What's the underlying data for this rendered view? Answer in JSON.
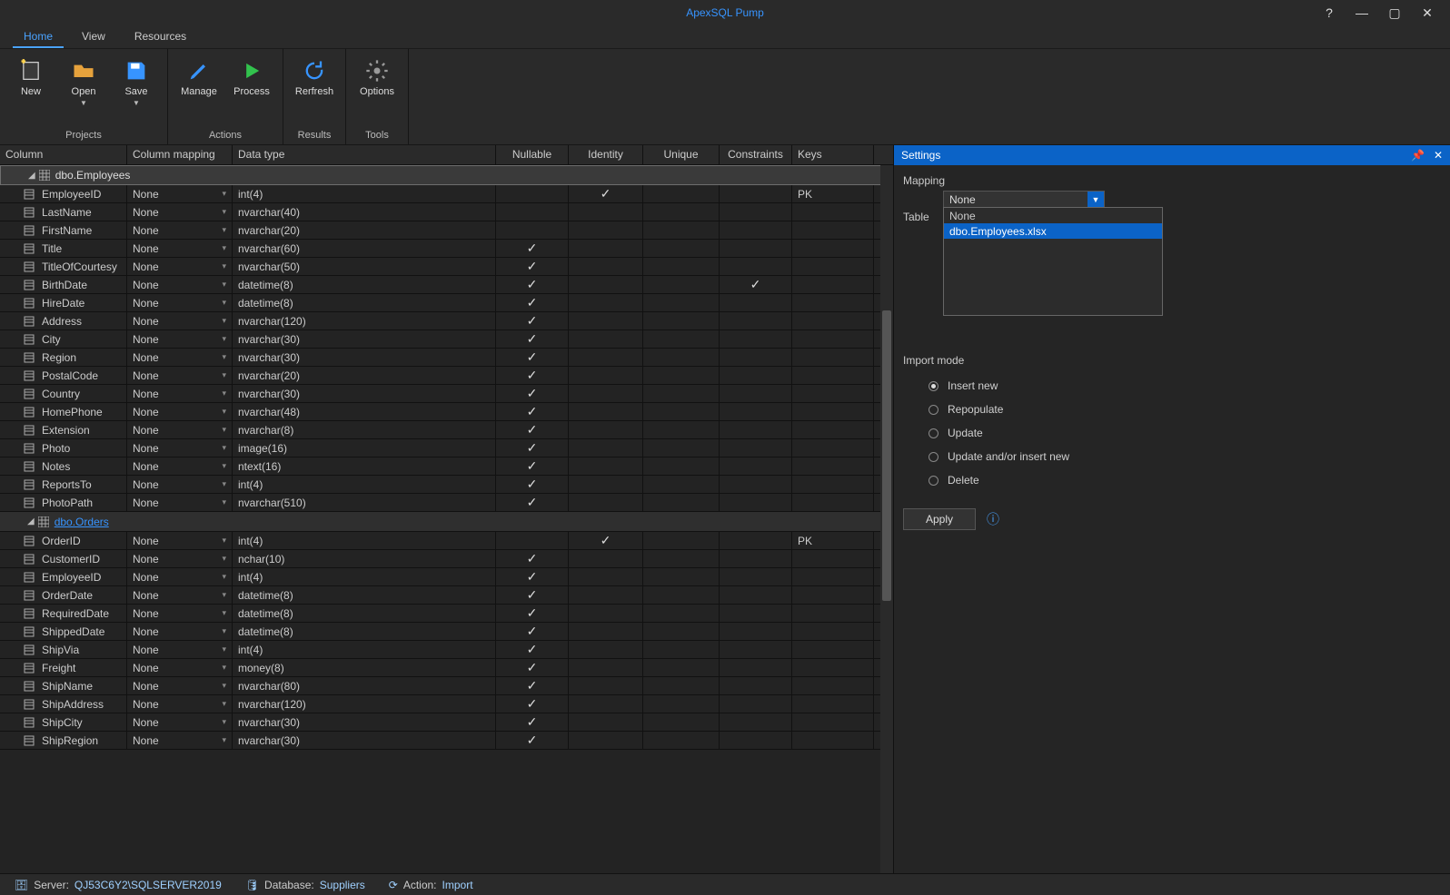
{
  "app_title": "ApexSQL Pump",
  "ribbon_tabs": [
    "Home",
    "View",
    "Resources"
  ],
  "active_tab": 0,
  "ribbon_groups": [
    {
      "label": "Projects",
      "buttons": [
        {
          "name": "New",
          "dropdown": false
        },
        {
          "name": "Open",
          "dropdown": true
        },
        {
          "name": "Save",
          "dropdown": true
        }
      ]
    },
    {
      "label": "Actions",
      "buttons": [
        {
          "name": "Manage",
          "dropdown": false
        },
        {
          "name": "Process",
          "dropdown": false
        }
      ]
    },
    {
      "label": "Results",
      "buttons": [
        {
          "name": "Rerfresh",
          "dropdown": false
        }
      ]
    },
    {
      "label": "Tools",
      "buttons": [
        {
          "name": "Options",
          "dropdown": false
        }
      ]
    }
  ],
  "grid_columns": [
    "Column",
    "Column mapping",
    "Data type",
    "Nullable",
    "Identity",
    "Unique",
    "Constraints",
    "Keys"
  ],
  "tables": [
    {
      "name": "dbo.Employees",
      "selected": true,
      "link": false,
      "cols": [
        {
          "n": "EmployeeID",
          "m": "None",
          "t": "int(4)",
          "nul": false,
          "id": true,
          "uq": false,
          "cn": false,
          "k": "PK"
        },
        {
          "n": "LastName",
          "m": "None",
          "t": "nvarchar(40)",
          "nul": false,
          "id": false,
          "uq": false,
          "cn": false,
          "k": ""
        },
        {
          "n": "FirstName",
          "m": "None",
          "t": "nvarchar(20)",
          "nul": false,
          "id": false,
          "uq": false,
          "cn": false,
          "k": ""
        },
        {
          "n": "Title",
          "m": "None",
          "t": "nvarchar(60)",
          "nul": true,
          "id": false,
          "uq": false,
          "cn": false,
          "k": ""
        },
        {
          "n": "TitleOfCourtesy",
          "m": "None",
          "t": "nvarchar(50)",
          "nul": true,
          "id": false,
          "uq": false,
          "cn": false,
          "k": ""
        },
        {
          "n": "BirthDate",
          "m": "None",
          "t": "datetime(8)",
          "nul": true,
          "id": false,
          "uq": false,
          "cn": true,
          "k": ""
        },
        {
          "n": "HireDate",
          "m": "None",
          "t": "datetime(8)",
          "nul": true,
          "id": false,
          "uq": false,
          "cn": false,
          "k": ""
        },
        {
          "n": "Address",
          "m": "None",
          "t": "nvarchar(120)",
          "nul": true,
          "id": false,
          "uq": false,
          "cn": false,
          "k": ""
        },
        {
          "n": "City",
          "m": "None",
          "t": "nvarchar(30)",
          "nul": true,
          "id": false,
          "uq": false,
          "cn": false,
          "k": ""
        },
        {
          "n": "Region",
          "m": "None",
          "t": "nvarchar(30)",
          "nul": true,
          "id": false,
          "uq": false,
          "cn": false,
          "k": ""
        },
        {
          "n": "PostalCode",
          "m": "None",
          "t": "nvarchar(20)",
          "nul": true,
          "id": false,
          "uq": false,
          "cn": false,
          "k": ""
        },
        {
          "n": "Country",
          "m": "None",
          "t": "nvarchar(30)",
          "nul": true,
          "id": false,
          "uq": false,
          "cn": false,
          "k": ""
        },
        {
          "n": "HomePhone",
          "m": "None",
          "t": "nvarchar(48)",
          "nul": true,
          "id": false,
          "uq": false,
          "cn": false,
          "k": ""
        },
        {
          "n": "Extension",
          "m": "None",
          "t": "nvarchar(8)",
          "nul": true,
          "id": false,
          "uq": false,
          "cn": false,
          "k": ""
        },
        {
          "n": "Photo",
          "m": "None",
          "t": "image(16)",
          "nul": true,
          "id": false,
          "uq": false,
          "cn": false,
          "k": ""
        },
        {
          "n": "Notes",
          "m": "None",
          "t": "ntext(16)",
          "nul": true,
          "id": false,
          "uq": false,
          "cn": false,
          "k": ""
        },
        {
          "n": "ReportsTo",
          "m": "None",
          "t": "int(4)",
          "nul": true,
          "id": false,
          "uq": false,
          "cn": false,
          "k": ""
        },
        {
          "n": "PhotoPath",
          "m": "None",
          "t": "nvarchar(510)",
          "nul": true,
          "id": false,
          "uq": false,
          "cn": false,
          "k": ""
        }
      ]
    },
    {
      "name": "dbo.Orders",
      "selected": false,
      "link": true,
      "cols": [
        {
          "n": "OrderID",
          "m": "None",
          "t": "int(4)",
          "nul": false,
          "id": true,
          "uq": false,
          "cn": false,
          "k": "PK"
        },
        {
          "n": "CustomerID",
          "m": "None",
          "t": "nchar(10)",
          "nul": true,
          "id": false,
          "uq": false,
          "cn": false,
          "k": ""
        },
        {
          "n": "EmployeeID",
          "m": "None",
          "t": "int(4)",
          "nul": true,
          "id": false,
          "uq": false,
          "cn": false,
          "k": ""
        },
        {
          "n": "OrderDate",
          "m": "None",
          "t": "datetime(8)",
          "nul": true,
          "id": false,
          "uq": false,
          "cn": false,
          "k": ""
        },
        {
          "n": "RequiredDate",
          "m": "None",
          "t": "datetime(8)",
          "nul": true,
          "id": false,
          "uq": false,
          "cn": false,
          "k": ""
        },
        {
          "n": "ShippedDate",
          "m": "None",
          "t": "datetime(8)",
          "nul": true,
          "id": false,
          "uq": false,
          "cn": false,
          "k": ""
        },
        {
          "n": "ShipVia",
          "m": "None",
          "t": "int(4)",
          "nul": true,
          "id": false,
          "uq": false,
          "cn": false,
          "k": ""
        },
        {
          "n": "Freight",
          "m": "None",
          "t": "money(8)",
          "nul": true,
          "id": false,
          "uq": false,
          "cn": false,
          "k": ""
        },
        {
          "n": "ShipName",
          "m": "None",
          "t": "nvarchar(80)",
          "nul": true,
          "id": false,
          "uq": false,
          "cn": false,
          "k": ""
        },
        {
          "n": "ShipAddress",
          "m": "None",
          "t": "nvarchar(120)",
          "nul": true,
          "id": false,
          "uq": false,
          "cn": false,
          "k": ""
        },
        {
          "n": "ShipCity",
          "m": "None",
          "t": "nvarchar(30)",
          "nul": true,
          "id": false,
          "uq": false,
          "cn": false,
          "k": ""
        },
        {
          "n": "ShipRegion",
          "m": "None",
          "t": "nvarchar(30)",
          "nul": true,
          "id": false,
          "uq": false,
          "cn": false,
          "k": ""
        }
      ]
    }
  ],
  "settings": {
    "title": "Settings",
    "mapping_label": "Mapping",
    "mapping_value": "None",
    "table_label": "Table",
    "dropdown_options": [
      "None",
      "dbo.Employees.xlsx"
    ],
    "dropdown_selected_index": 1,
    "import_mode_label": "Import mode",
    "import_modes": [
      "Insert new",
      "Repopulate",
      "Update",
      "Update and/or insert new",
      "Delete"
    ],
    "import_mode_selected": 0,
    "apply_label": "Apply"
  },
  "statusbar": {
    "server_label": "Server:",
    "server_value": "QJ53C6Y2\\SQLSERVER2019",
    "database_label": "Database:",
    "database_value": "Suppliers",
    "action_label": "Action:",
    "action_value": "Import"
  },
  "colors": {
    "accent": "#0b63c7",
    "accent_light": "#3794ff",
    "bg": "#232323",
    "panel": "#2a2a2a"
  }
}
